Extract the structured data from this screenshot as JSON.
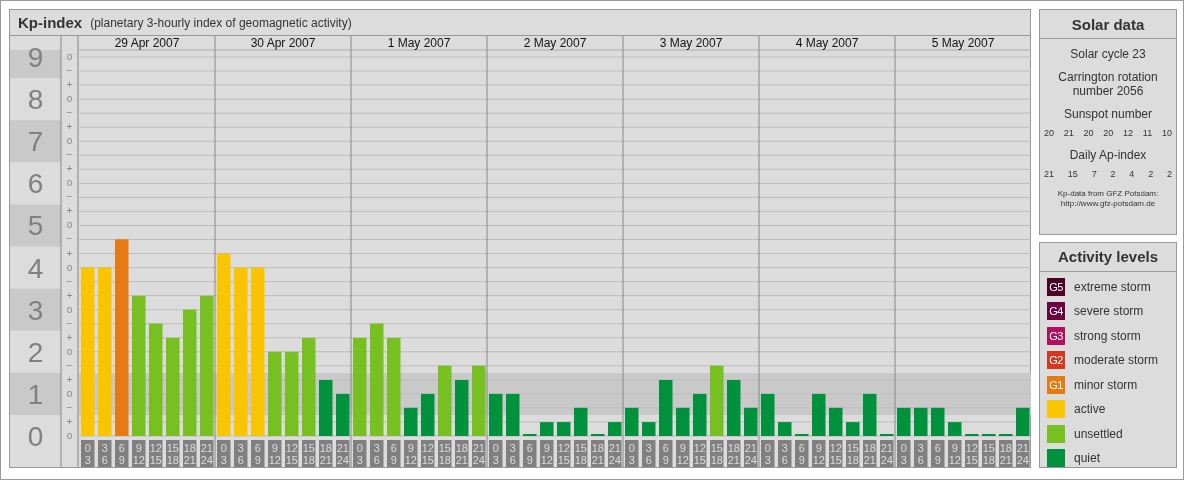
{
  "kp_panel": {
    "title": "Kp-index",
    "subtitle": "(planetary 3-hourly index of geomagnetic activity)",
    "days": [
      "29 Apr 2007",
      "30 Apr 2007",
      "1 May 2007",
      "2 May 2007",
      "3 May 2007",
      "4 May 2007",
      "5 May 2007"
    ],
    "chart_data": {
      "type": "bar",
      "ylim": [
        0,
        9
      ],
      "grid": true,
      "yticks": [
        0,
        1,
        2,
        3,
        4,
        5,
        6,
        7,
        8,
        9
      ],
      "categories": [
        "0 3",
        "3 6",
        "6 9",
        "9 12",
        "12 15",
        "15 18",
        "18 21",
        "21 24",
        "0 3",
        "3 6",
        "6 9",
        "9 12",
        "12 15",
        "15 18",
        "18 21",
        "21 24",
        "0 3",
        "3 6",
        "6 9",
        "9 12",
        "12 15",
        "15 18",
        "18 21",
        "21 24",
        "0 3",
        "3 6",
        "6 9",
        "9 12",
        "12 15",
        "15 18",
        "18 21",
        "21 24",
        "0 3",
        "3 6",
        "6 9",
        "9 12",
        "12 15",
        "15 18",
        "18 21",
        "21 24",
        "0 3",
        "3 6",
        "6 9",
        "9 12",
        "12 15",
        "15 18",
        "18 21",
        "21 24",
        "0 3",
        "3 6",
        "6 9",
        "9 12",
        "12 15",
        "15 18",
        "18 21",
        "21 24"
      ],
      "series": [
        {
          "color": "#e67a15",
          "values": [
            null,
            null,
            4.67,
            null,
            null,
            null,
            null,
            null,
            null,
            null,
            null,
            null,
            null,
            null,
            null,
            null,
            null,
            null,
            null,
            null,
            null,
            null,
            null,
            null,
            null,
            null,
            null,
            null,
            null,
            null,
            null,
            null,
            null,
            null,
            null,
            null,
            null,
            null,
            null,
            null,
            null,
            null,
            null,
            null,
            null,
            null,
            null,
            null,
            null,
            null,
            null,
            null,
            null,
            null,
            null,
            null
          ]
        },
        {
          "color": "#f9c400",
          "values": [
            4,
            4,
            null,
            null,
            null,
            null,
            null,
            null,
            4.33,
            4,
            4,
            null,
            null,
            null,
            null,
            null,
            null,
            null,
            null,
            null,
            null,
            null,
            null,
            null,
            null,
            null,
            null,
            null,
            null,
            null,
            null,
            null,
            null,
            null,
            null,
            null,
            null,
            null,
            null,
            null,
            null,
            null,
            null,
            null,
            null,
            null,
            null,
            null,
            null,
            null,
            null,
            null,
            null,
            null,
            null,
            null
          ]
        },
        {
          "color": "#78c022",
          "values": [
            null,
            null,
            null,
            3.33,
            2.67,
            2.33,
            3,
            3.33,
            null,
            null,
            null,
            2,
            2,
            2.33,
            null,
            null,
            2.33,
            2.67,
            2.33,
            null,
            null,
            1.67,
            null,
            1.67,
            null,
            null,
            null,
            null,
            null,
            null,
            null,
            null,
            null,
            null,
            null,
            null,
            null,
            1.67,
            null,
            null,
            null,
            null,
            null,
            null,
            null,
            null,
            null,
            null,
            null,
            null,
            null,
            null,
            null,
            null,
            null,
            null
          ]
        },
        {
          "color": "#00913c",
          "values": [
            null,
            null,
            null,
            null,
            null,
            null,
            null,
            null,
            null,
            null,
            null,
            null,
            null,
            null,
            1.33,
            1,
            null,
            null,
            null,
            0.67,
            1,
            null,
            1.33,
            null,
            1,
            1,
            0,
            0.33,
            0.33,
            0.67,
            0,
            0.33,
            0.67,
            0.33,
            1.33,
            0.67,
            1,
            null,
            1.33,
            0.67,
            1,
            0.33,
            0,
            1,
            0.67,
            0.33,
            1,
            0,
            0.67,
            0.67,
            0.67,
            0.33,
            0,
            0,
            0,
            0.67
          ]
        }
      ]
    },
    "minor_tick_labels": [
      "o",
      "−",
      "+",
      "o",
      "−",
      "+",
      "o",
      "−",
      "+",
      "o",
      "−",
      "+",
      "o",
      "−",
      "+",
      "o",
      "−",
      "+",
      "o",
      "−",
      "+",
      "o",
      "−",
      "+",
      "o",
      "−",
      "+",
      "o"
    ]
  },
  "solar_data": {
    "title": "Solar data",
    "cycle": "Solar cycle 23",
    "carrington": "Carrington rotation number 2056",
    "sunspot_label": "Sunspot number",
    "sunspot_numbers": [
      "20",
      "21",
      "20",
      "20",
      "12",
      "11",
      "10"
    ],
    "ap_label": "Daily Ap-index",
    "ap_values": [
      "21",
      "15",
      "7",
      "2",
      "4",
      "2",
      "2"
    ],
    "credit": "Kp-data from GFZ Potsdam:",
    "credit_link": "http://www.gfz-potsdam.de"
  },
  "activity_levels": {
    "title": "Activity levels",
    "items": [
      {
        "code": "G5",
        "label": "extreme storm",
        "color": "#4a0022"
      },
      {
        "code": "G4",
        "label": "severe storm",
        "color": "#6c0040"
      },
      {
        "code": "G3",
        "label": "strong storm",
        "color": "#b2105e"
      },
      {
        "code": "G2",
        "label": "moderate storm",
        "color": "#d8361c"
      },
      {
        "code": "G1",
        "label": "minor storm",
        "color": "#e67a15"
      },
      {
        "label": "active",
        "color": "#f9c400"
      },
      {
        "label": "unsettled",
        "color": "#78c022"
      },
      {
        "label": "quiet",
        "color": "#00913c"
      }
    ]
  }
}
